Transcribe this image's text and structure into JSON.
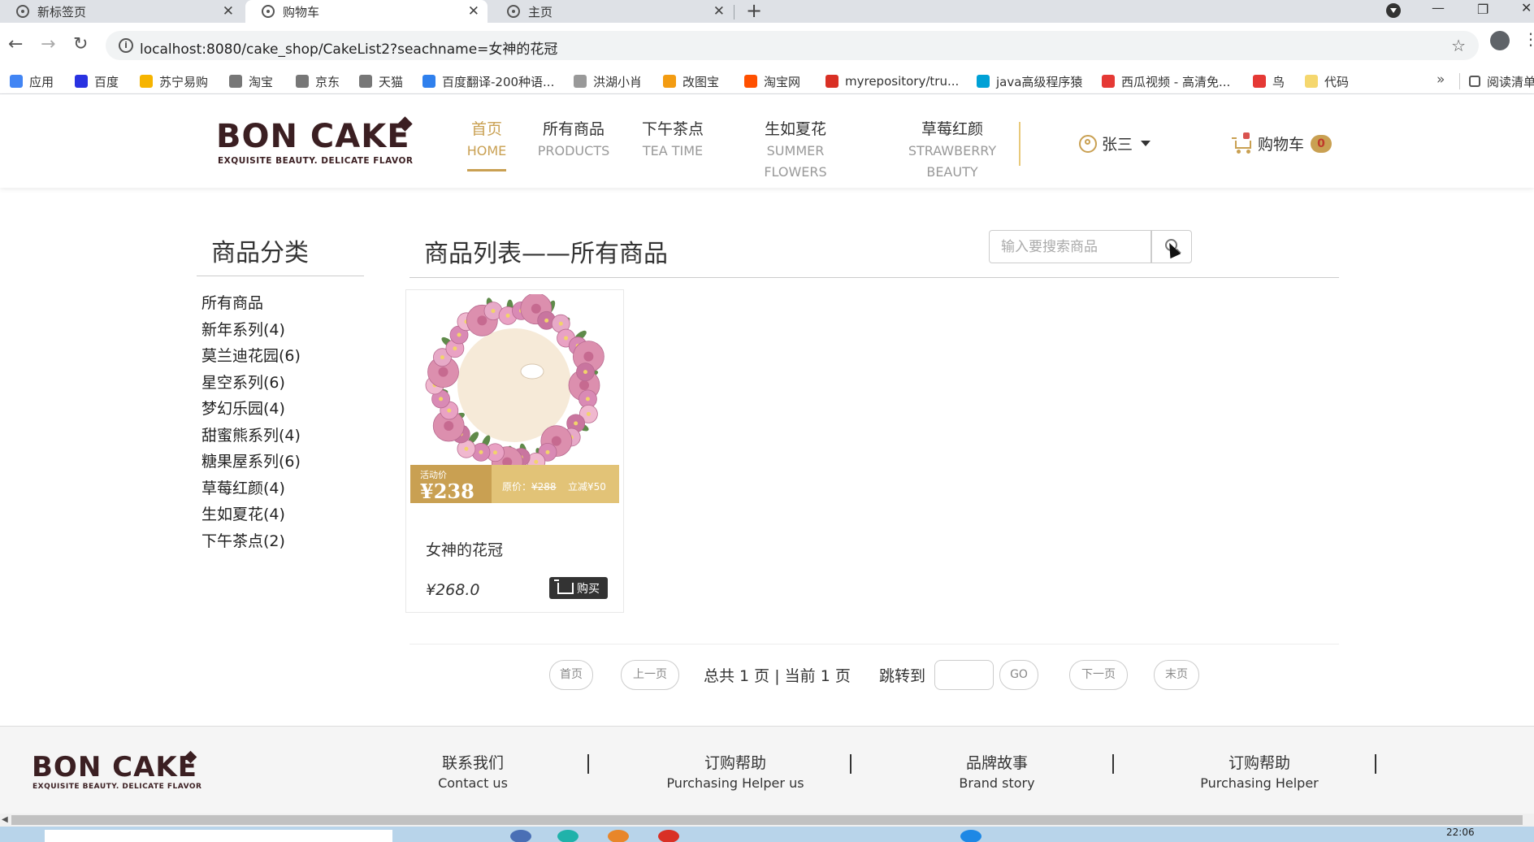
{
  "browser": {
    "tabs": [
      {
        "title": "新标签页",
        "active": false
      },
      {
        "title": "购物车",
        "active": true
      },
      {
        "title": "主页",
        "active": false
      }
    ],
    "url": "localhost:8080/cake_shop/CakeList2?seachname=女神的花冠",
    "bookmarks": [
      {
        "label": "应用",
        "color": "#4285f4"
      },
      {
        "label": "百度",
        "color": "#2932e1"
      },
      {
        "label": "苏宁易购",
        "color": "#f6b400"
      },
      {
        "label": "淘宝",
        "color": "#777777"
      },
      {
        "label": "京东",
        "color": "#777777"
      },
      {
        "label": "天猫",
        "color": "#777777"
      },
      {
        "label": "百度翻译-200种语...",
        "color": "#2f80ed"
      },
      {
        "label": "洪湖小肖",
        "color": "#999999"
      },
      {
        "label": "改图宝",
        "color": "#f39c12"
      },
      {
        "label": "淘宝网",
        "color": "#ff5000"
      },
      {
        "label": "myrepository/tru...",
        "color": "#d93025"
      },
      {
        "label": "java高级程序猿",
        "color": "#00a1d6"
      },
      {
        "label": "西瓜视频 - 高清免...",
        "color": "#e53935"
      },
      {
        "label": "鸟",
        "color": "#e53935"
      },
      {
        "label": "代码",
        "color": "#f5d76e"
      }
    ],
    "reading_list": "阅读清单"
  },
  "header": {
    "logo": {
      "main": "BON CAKE",
      "sub": "EXQUISITE BEAUTY. DELICATE FLAVOR"
    },
    "nav": [
      {
        "cn": "首页",
        "en": "HOME",
        "active": true
      },
      {
        "cn": "所有商品",
        "en": "PRODUCTS",
        "active": false
      },
      {
        "cn": "下午茶点",
        "en": "TEA TIME",
        "active": false
      },
      {
        "cn": "生如夏花",
        "en": "SUMMER FLOWERS",
        "active": false
      },
      {
        "cn": "草莓红颜",
        "en": "STRAWBERRY BEAUTY",
        "active": false
      }
    ],
    "user_name": "张三",
    "cart_label": "购物车",
    "cart_count": "0"
  },
  "sidebar": {
    "title": "商品分类",
    "items": [
      "所有商品",
      "新年系列(4)",
      "莫兰迪花园(6)",
      "星空系列(6)",
      "梦幻乐园(4)",
      "甜蜜熊系列(4)",
      "糖果屋系列(6)",
      "草莓红颜(4)",
      "生如夏花(4)",
      "下午茶点(2)"
    ]
  },
  "main": {
    "title": "商品列表——所有商品",
    "search_placeholder": "输入要搜索商品"
  },
  "product": {
    "name": "女神的花冠",
    "price": "¥268.0",
    "promo_tag": "活动价",
    "promo_price": "¥238",
    "orig_label": "原价：",
    "orig_price": "¥288",
    "discount": "立减¥50",
    "buy_label": "购买"
  },
  "pager": {
    "first": "首页",
    "prev": "上一页",
    "summary": "总共 1 页 | 当前 1 页",
    "jump_label": "跳转到",
    "go": "GO",
    "next": "下一页",
    "last": "末页"
  },
  "footer": {
    "logo": {
      "main": "BON CAKE",
      "sub": "EXQUISITE BEAUTY. DELICATE FLAVOR"
    },
    "links": [
      {
        "cn": "联系我们",
        "en": "Contact us"
      },
      {
        "cn": "订购帮助",
        "en": "Purchasing Helper us"
      },
      {
        "cn": "品牌故事",
        "en": "Brand story"
      },
      {
        "cn": "订购帮助",
        "en": "Purchasing Helper"
      }
    ]
  },
  "taskbar": {
    "clock": "22:06"
  },
  "colors": {
    "accent": "#c9a052",
    "brand": "#3b1f22",
    "badge_text": "#c0392b"
  }
}
